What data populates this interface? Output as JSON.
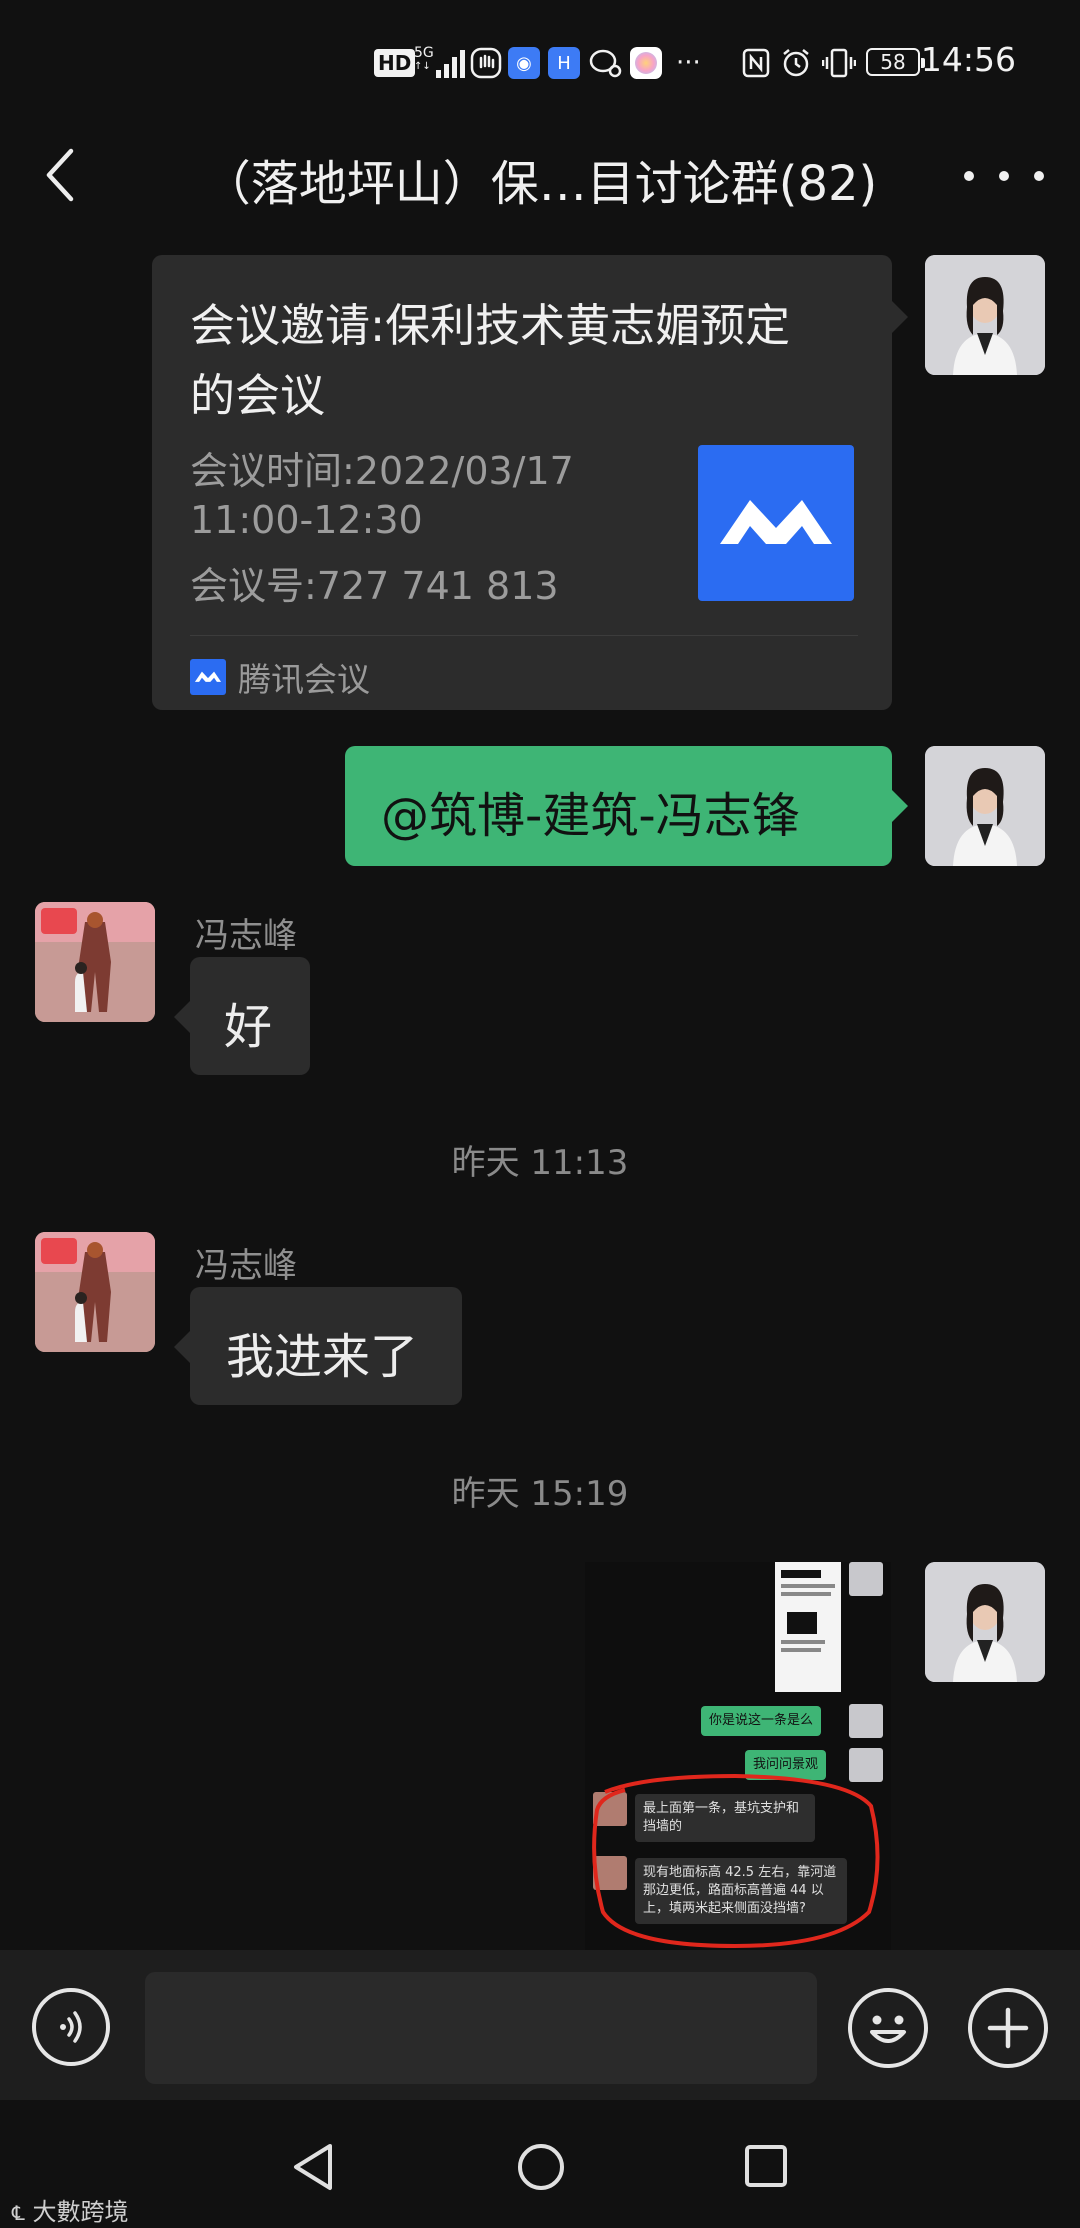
{
  "status_bar": {
    "hd": "HD",
    "network": "5G",
    "battery": "58",
    "time": "14:56",
    "icons": [
      "hd-badge-icon",
      "signal-icon",
      "hand-icon",
      "bulb-icon",
      "app-icon",
      "chat-icon",
      "photos-icon",
      "more-dots-icon",
      "nfc-icon",
      "alarm-icon",
      "vibrate-icon",
      "battery-icon"
    ]
  },
  "header": {
    "title": "（落地坪山）保…目讨论群(82)",
    "back_icon": "back-arrow-icon",
    "more_icon": "more-dots-icon"
  },
  "messages": {
    "meeting_card": {
      "title": "会议邀请:保利技术黄志媚预定的会议",
      "time_line1": "会议时间:2022/03/17",
      "time_line2": "11:00-12:30",
      "meeting_id": "会议号:727 741 813",
      "source": "腾讯会议"
    },
    "mention": {
      "text": "@筑博-建筑-冯志锋"
    },
    "incoming_1": {
      "sender": "冯志峰",
      "text": "好"
    },
    "separator_1": "昨天 11:13",
    "incoming_2": {
      "sender": "冯志峰",
      "text": "我进来了"
    },
    "separator_2": "昨天 15:19",
    "screenshot": {
      "bubble_1": "你是说这一条是么",
      "bubble_2": "我问问景观",
      "bubble_3": "最上面第一条，基坑支护和挡墙的",
      "bubble_4": "现有地面标高 42.5 左右，靠河道那边更低，路面标高普遍 44 以上，填两米起来侧面没挡墙?"
    }
  },
  "input_bar": {
    "placeholder": "",
    "voice_icon": "voice-icon",
    "emoji_icon": "emoji-icon",
    "plus_icon": "plus-icon"
  },
  "nav": {
    "icons": [
      "nav-back-icon",
      "nav-home-icon",
      "nav-recents-icon"
    ]
  },
  "watermark": "大數跨境",
  "colors": {
    "background": "#111111",
    "bubble_gray": "#2c2c2c",
    "bubble_green": "#3eb575",
    "meeting_blue": "#2b6cf2",
    "annotation_red": "#e0271c"
  }
}
